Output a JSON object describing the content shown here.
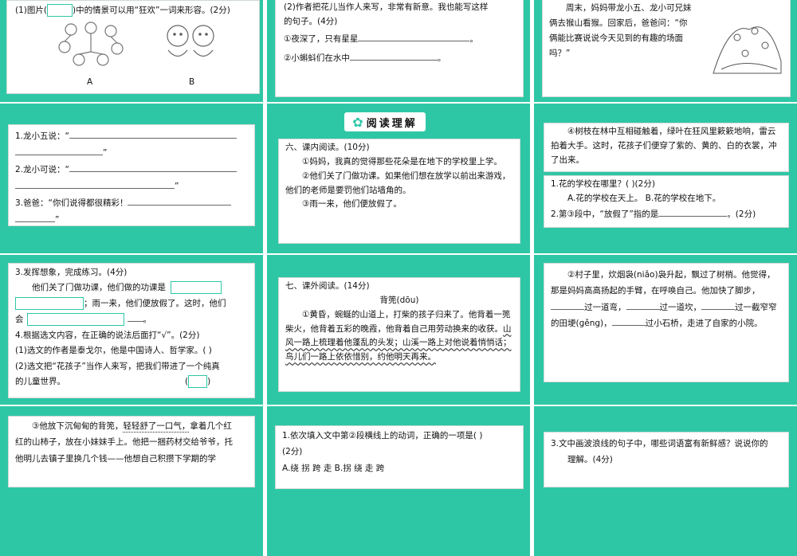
{
  "s1": {
    "q1a": "(1)图片(",
    "q1b": ")中的情景可以用“狂欢”一词来形容。(2分)",
    "labelA": "A",
    "labelB": "B"
  },
  "s2": {
    "line1": "(2)作者把花儿当作人来写，非常有新意。我也能写这样",
    "line2": "的句子。(4分)",
    "item1": "①夜深了，只有星星",
    "item2": "②小蝌蚪们在水中",
    "dot": "。"
  },
  "s3": {
    "text": "周末，妈妈带龙小五、龙小可兄妹俩去猴山看猴。回家后，爸爸问：“你俩能比赛说说今天见到的有趣的场面吗？”"
  },
  "s4": {
    "q1": "1.龙小五说：“",
    "q2": "2.龙小可说：“",
    "q3": "3.爸爸：“你们说得都很精彩！",
    "close": "”"
  },
  "s5": {
    "header": "阅读理解",
    "title": "六、课内阅读。(10分)",
    "p1": "①妈妈，我真的觉得那些花朵是在地下的学校里上学。",
    "p2": "②他们关了门做功课。如果他们想在放学以前出来游戏，他们的老师是要罚他们站墙角的。",
    "p3": "③雨一来，他们便放假了。"
  },
  "s6": {
    "p4": "④树枝在林中互相碰触着，绿叶在狂风里簌簌地响，雷云拍着大手。这时，花孩子们便穿了紫的、黄的、白的衣裳，冲了出来。",
    "q1": "1.花的学校在哪里？(   )(2分)",
    "q1opts": "A.花的学校在天上。    B.花的学校在地下。",
    "q2a": "2.第③段中，“放假了”指的是",
    "q2b": "。(2分)"
  },
  "s7": {
    "q3": "3.发挥想象，完成练习。(4分)",
    "l1": "他们关了门做功课，他们做的功课是",
    "l2": "；雨一来，他们便放假了。这时，他们",
    "l3a": "会",
    "l3b": "。",
    "q4": "4.根据选文内容，在正确的说法后面打“√”。(2分)",
    "s1": "(1)选文的作者是泰戈尔，他是中国诗人、哲学家。(    )",
    "s2": "(2)选文把“花孩子”当作人来写，把我们带进了一个纯真",
    "s3": "的儿童世界。"
  },
  "s8": {
    "title": "七、课外阅读。(14分)",
    "subtitle": "背篼(dōu)",
    "p1a": "①黄昏，蜿蜒的山道上，打柴的孩子归来了。他背着一篼柴火，他背着五彩的晚霞，他背着自己用劳动换来的收获。",
    "p1b": "山风一路上梳理着他蓬乱的头发；山溪一路上对他说着悄悄话；鸟儿们一路上依依惜别，约他明天再来。"
  },
  "s9": {
    "p2a": "②村子里，炊烟袅(niǎo)袅升起，飘过了树梢。他觉得，那是妈妈高高扬起的手臂，在呼唤自己。他加快了脚步，",
    "w1": "过一道弯，",
    "w2": "过一道坎，",
    "w3": "过一截窄窄的田埂(gěng)，",
    "w4": "过小石桥，走进了自家的小院。"
  },
  "s10": {
    "p3a": "③他放下沉甸甸的背篼，",
    "p3b": "轻轻舒了一口气，",
    "p3c": "拿着几个红",
    "l2": "红的山柿子，放在小妹妹手上。他把一捆药材交给爷爷，托",
    "l3": "他明儿去镇子里换几个钱——他想自己积攒下学期的学"
  },
  "s11": {
    "q1": "1.依次填入文中第②段横线上的动词，正确的一项是(    )",
    "score": "(2分)",
    "opts": "A.绕  拐  跨  走      B.拐  绕  走  跨"
  },
  "s12": {
    "q3": "3.文中画波浪线的句子中，哪些词语富有新鲜感？说说你的",
    "q3b": "理解。(4分)"
  }
}
